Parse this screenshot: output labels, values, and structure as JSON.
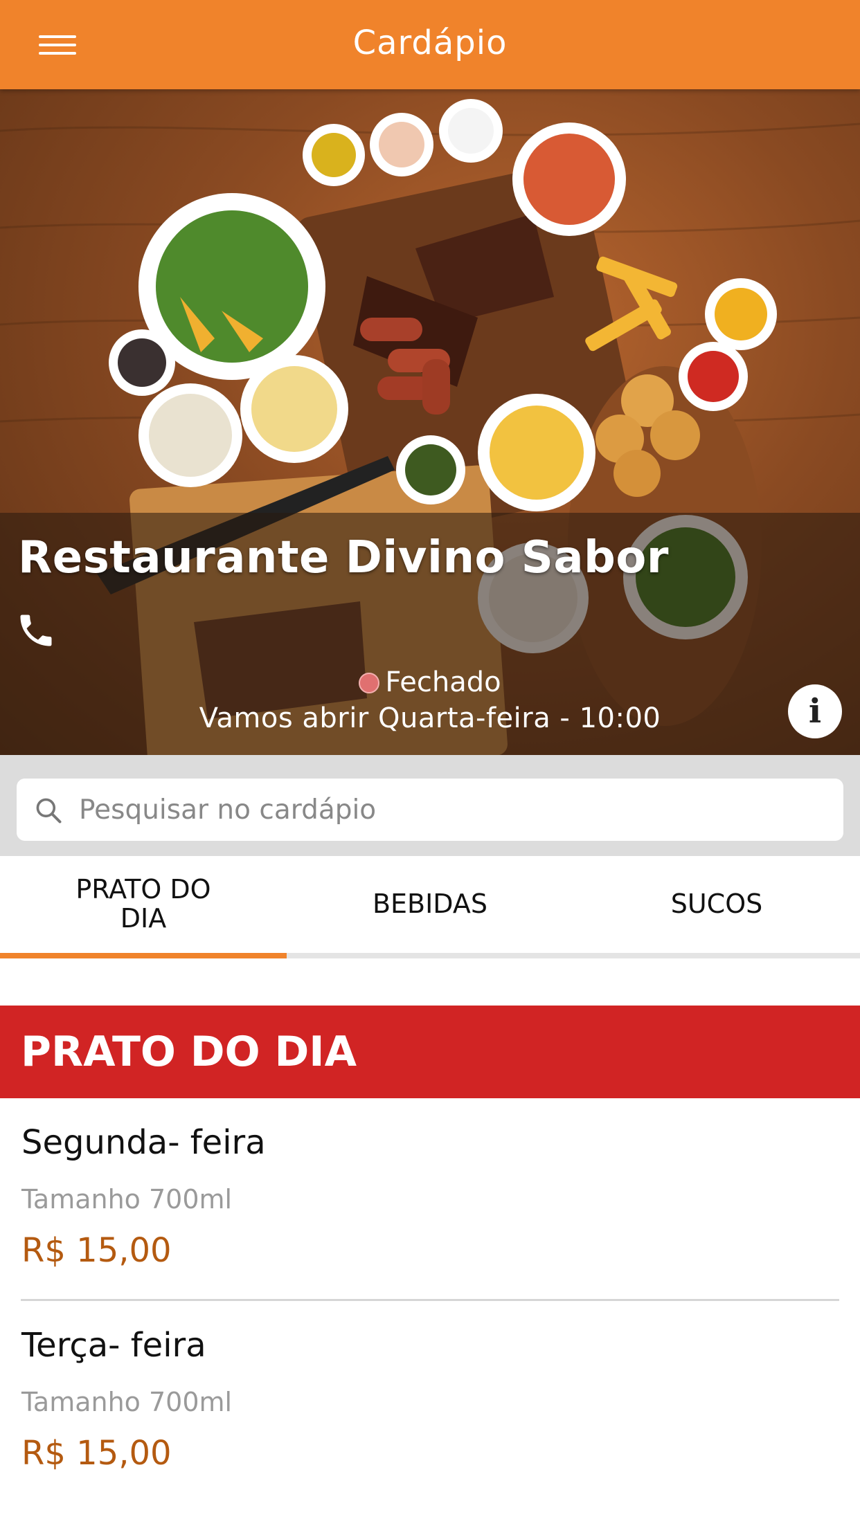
{
  "appbar": {
    "title": "Cardápio",
    "menu_icon": "hamburger-menu-icon",
    "color": "#F0832B"
  },
  "hero": {
    "restaurant_name": "Restaurante Divino Sabor",
    "phone_icon": "phone-icon",
    "status": "Fechado",
    "status_color": "#e07070",
    "opening_info": "Vamos abrir Quarta-feira - 10:00",
    "info_icon": "info-icon"
  },
  "search": {
    "placeholder": "Pesquisar no cardápio",
    "value": ""
  },
  "tabs": [
    {
      "label": "PRATO DO DIA",
      "active": true
    },
    {
      "label": "BEBIDAS",
      "active": false
    },
    {
      "label": "SUCOS",
      "active": false
    }
  ],
  "section": {
    "title": "PRATO DO DIA",
    "color": "#D12424"
  },
  "items": [
    {
      "name": "Segunda- feira",
      "description": "Tamanho 700ml",
      "price": "R$ 15,00"
    },
    {
      "name": "Terça- feira",
      "description": "Tamanho 700ml",
      "price": "R$ 15,00"
    }
  ]
}
